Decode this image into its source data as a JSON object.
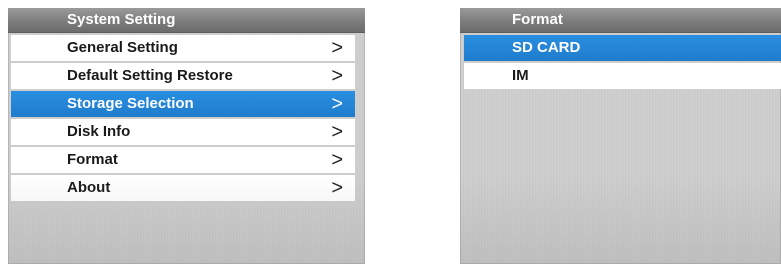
{
  "system_setting": {
    "title": "System Setting",
    "items": [
      {
        "label": "General Setting",
        "arrow": ">"
      },
      {
        "label": "Default Setting Restore",
        "arrow": ">"
      },
      {
        "label": "Storage Selection",
        "arrow": ">"
      },
      {
        "label": "Disk Info",
        "arrow": ">"
      },
      {
        "label": "Format",
        "arrow": ">"
      },
      {
        "label": "About",
        "arrow": ">"
      }
    ],
    "selected_index": 2
  },
  "format": {
    "title": "Format",
    "items": [
      {
        "label": "SD CARD"
      },
      {
        "label": "IM"
      }
    ],
    "selected_index": 0
  },
  "colors": {
    "selection": "#1f7ccc",
    "title_bar": "#7d7d7d",
    "panel_bg": "#cccccc"
  }
}
